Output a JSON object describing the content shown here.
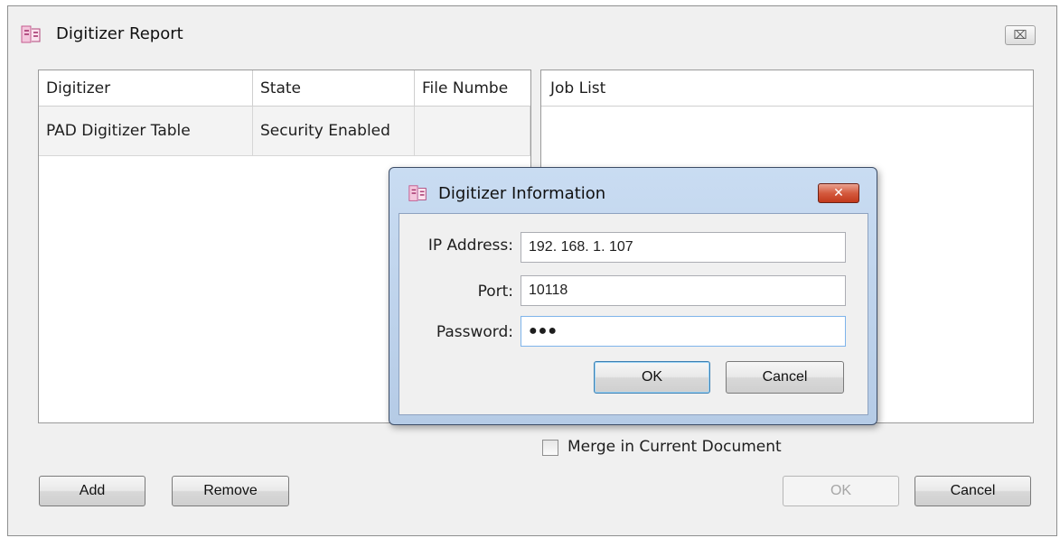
{
  "main": {
    "title": "Digitizer Report",
    "close_symbol": "⌧",
    "table": {
      "columns": [
        "Digitizer",
        "State",
        "File Numbe"
      ],
      "rows": [
        [
          "PAD Digitizer Table",
          "Security Enabled",
          ""
        ]
      ]
    },
    "job_list": {
      "header": "Job List"
    },
    "merge_label": "Merge in Current Document",
    "merge_checked": false,
    "buttons": {
      "add": "Add",
      "remove": "Remove",
      "ok": "OK",
      "cancel": "Cancel"
    }
  },
  "dialog": {
    "title": "Digitizer Information",
    "close_symbol": "✕",
    "fields": {
      "ip": {
        "label": "IP Address:",
        "value": "192. 168. 1. 107"
      },
      "port": {
        "label": "Port:",
        "value": "10118"
      },
      "password": {
        "label": "Password:",
        "value": "●●●"
      }
    },
    "buttons": {
      "ok": "OK",
      "cancel": "Cancel"
    }
  },
  "icons": {
    "app": "digitizer-app-icon",
    "close": "close-icon"
  },
  "colors": {
    "dialog_frame": "#b5cbe6",
    "close_red": "#c2391c",
    "default_button_border": "#3c7fb1"
  }
}
